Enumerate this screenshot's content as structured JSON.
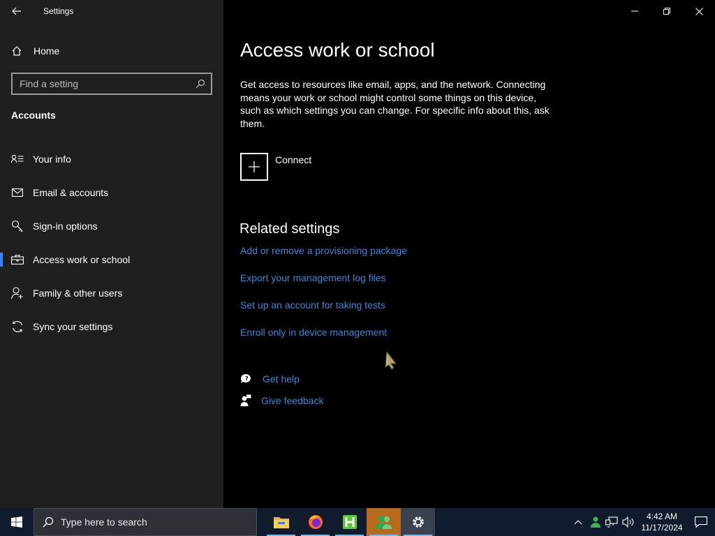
{
  "window": {
    "title": "Settings"
  },
  "sidebar": {
    "home_label": "Home",
    "search_placeholder": "Find a setting",
    "section_title": "Accounts",
    "items": [
      {
        "label": "Your info",
        "icon": "contact-info-icon"
      },
      {
        "label": "Email & accounts",
        "icon": "mail-icon"
      },
      {
        "label": "Sign-in options",
        "icon": "key-icon"
      },
      {
        "label": "Access work or school",
        "icon": "briefcase-icon",
        "active": true
      },
      {
        "label": "Family & other users",
        "icon": "person-add-icon"
      },
      {
        "label": "Sync your settings",
        "icon": "sync-icon"
      }
    ]
  },
  "main": {
    "title": "Access work or school",
    "description": "Get access to resources like email, apps, and the network. Connecting means your work or school might control some things on this device, such as which settings you can change. For specific info about this, ask them.",
    "connect_label": "Connect",
    "related_title": "Related settings",
    "related_links": [
      "Add or remove a provisioning package",
      "Export your management log files",
      "Set up an account for taking tests",
      "Enroll only in device management"
    ],
    "get_help": "Get help",
    "give_feedback": "Give feedback"
  },
  "taskbar": {
    "search_text": "Type here to search",
    "apps": [
      "file-explorer-icon",
      "firefox-icon",
      "hex-editor-icon",
      "people-icon",
      "settings-icon"
    ],
    "time": "4:42 AM",
    "date": "11/17/2024"
  },
  "colors": {
    "accent": "#3b82f6",
    "link": "#3a86d6",
    "sidebar_bg": "#1f1f1f",
    "taskbar_bg": "#101b2d"
  }
}
